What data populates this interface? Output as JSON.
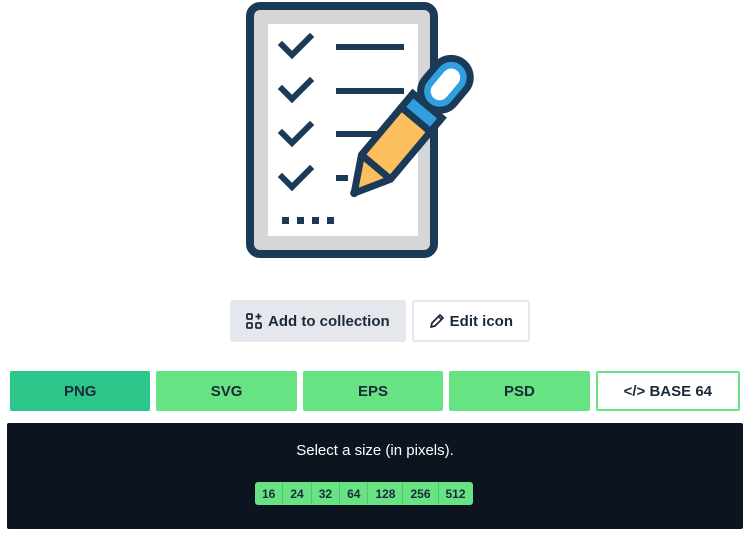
{
  "actions": {
    "add_to_collection": "Add to collection",
    "edit_icon": "Edit icon"
  },
  "formats": [
    {
      "label": "PNG"
    },
    {
      "label": "SVG"
    },
    {
      "label": "EPS"
    },
    {
      "label": "PSD"
    },
    {
      "label": "</> BASE 64"
    }
  ],
  "sizes": {
    "label": "Select a size (in pixels).",
    "options": [
      "16",
      "24",
      "32",
      "64",
      "128",
      "256",
      "512"
    ]
  },
  "icons": {
    "preview": "checklist-pencil-icon",
    "collection": "add-collection-icon",
    "edit": "pencil-icon"
  },
  "colors": {
    "navy": "#1b3a57",
    "paper_gray": "#d4d6d8",
    "pencil_orange": "#fdbf5e",
    "pencil_blue": "#2f9fe0",
    "green": "#67e383",
    "green_active": "#2cc58a",
    "panel_dark": "#0b141f"
  }
}
